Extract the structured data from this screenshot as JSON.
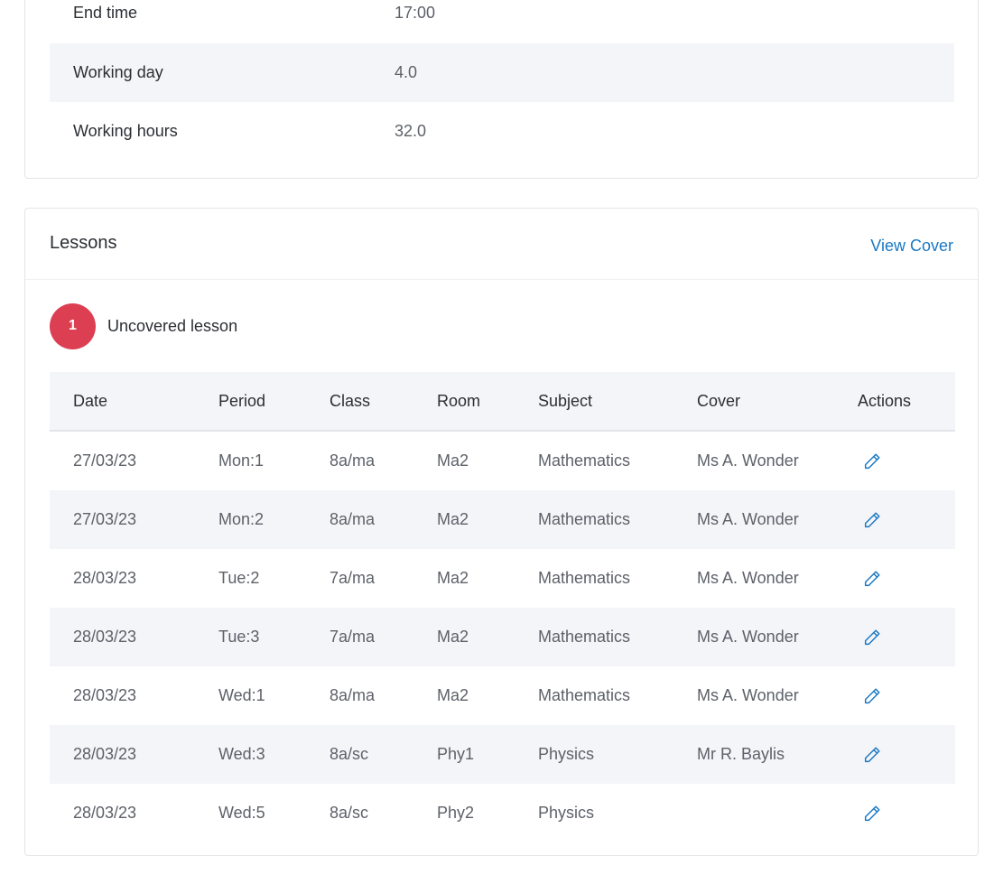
{
  "details": [
    {
      "label": "End time",
      "value": "17:00"
    },
    {
      "label": "Working day",
      "value": "4.0"
    },
    {
      "label": "Working hours",
      "value": "32.0"
    }
  ],
  "lessons": {
    "title": "Lessons",
    "view_cover_label": "View Cover",
    "uncovered_count": "1",
    "uncovered_label": "Uncovered lesson",
    "columns": [
      "Date",
      "Period",
      "Class",
      "Room",
      "Subject",
      "Cover",
      "Actions"
    ],
    "rows": [
      {
        "date": "27/03/23",
        "period": "Mon:1",
        "class": "8a/ma",
        "room": "Ma2",
        "subject": "Mathematics",
        "cover": "Ms A. Wonder"
      },
      {
        "date": "27/03/23",
        "period": "Mon:2",
        "class": "8a/ma",
        "room": "Ma2",
        "subject": "Mathematics",
        "cover": "Ms A. Wonder"
      },
      {
        "date": "28/03/23",
        "period": "Tue:2",
        "class": "7a/ma",
        "room": "Ma2",
        "subject": "Mathematics",
        "cover": "Ms A. Wonder"
      },
      {
        "date": "28/03/23",
        "period": "Tue:3",
        "class": "7a/ma",
        "room": "Ma2",
        "subject": "Mathematics",
        "cover": "Ms A. Wonder"
      },
      {
        "date": "28/03/23",
        "period": "Wed:1",
        "class": "8a/ma",
        "room": "Ma2",
        "subject": "Mathematics",
        "cover": "Ms A. Wonder"
      },
      {
        "date": "28/03/23",
        "period": "Wed:3",
        "class": "8a/sc",
        "room": "Phy1",
        "subject": "Physics",
        "cover": "Mr R. Baylis"
      },
      {
        "date": "28/03/23",
        "period": "Wed:5",
        "class": "8a/sc",
        "room": "Phy2",
        "subject": "Physics",
        "cover": ""
      }
    ],
    "action_icon": "pencil-edit-icon"
  },
  "colors": {
    "accent": "#1a78c2",
    "badge": "#dc3f52",
    "row_shade": "#f4f5f9"
  }
}
